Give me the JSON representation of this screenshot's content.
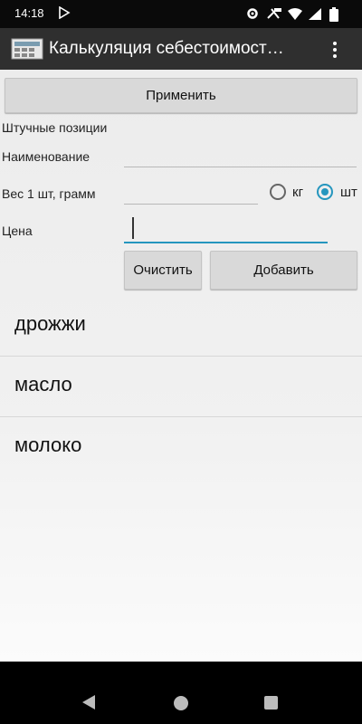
{
  "status_bar": {
    "time": "14:18"
  },
  "action_bar": {
    "title": "Калькуляция себестоимост…"
  },
  "apply_button": "Применить",
  "section_label": "Штучные позиции",
  "form": {
    "name_label": "Наименование",
    "name_value": "",
    "weight_label": "Вес 1 шт, грамм",
    "weight_value": "",
    "price_label": "Цена",
    "price_value": "",
    "unit_kg": "кг",
    "unit_sht": "шт",
    "selected_unit": "шт"
  },
  "clear_button": "Очистить",
  "add_button": "Добавить",
  "items": [
    "дрожжи",
    "масло",
    "молоко"
  ],
  "colors": {
    "accent": "#2596be",
    "action_bar": "#2f2f2f",
    "button": "#d9d9d9"
  },
  "icons": {
    "status": [
      "play-store-notification-icon",
      "settings-gear-icon",
      "wifi-icon",
      "signal-icon",
      "battery-icon"
    ],
    "action": [
      "app-icon",
      "overflow-menu-icon"
    ],
    "nav": [
      "back-icon",
      "home-icon",
      "recent-apps-icon"
    ]
  }
}
